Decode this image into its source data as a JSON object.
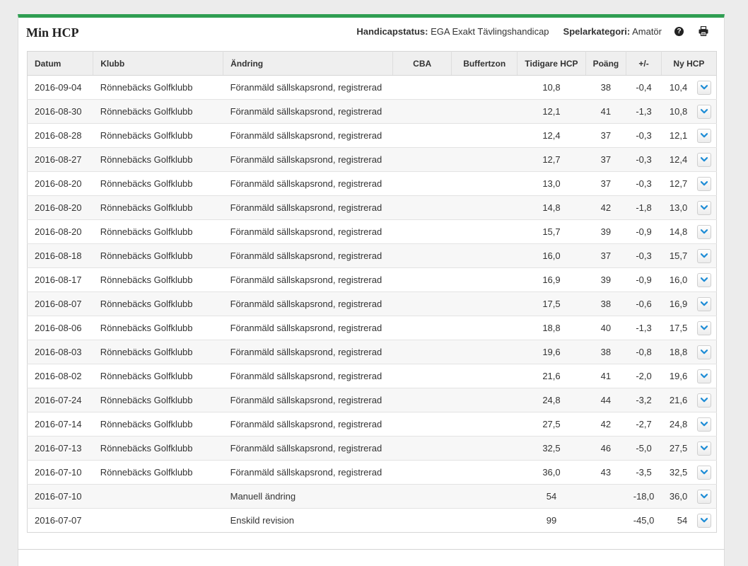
{
  "header": {
    "title": "Min HCP",
    "handicap_status_label": "Handicapstatus:",
    "handicap_status_value": "EGA Exakt Tävlingshandicap",
    "player_category_label": "Spelarkategori:",
    "player_category_value": "Amatör",
    "help_glyph": "?"
  },
  "colors": {
    "accent": "#2f9e52",
    "expand_chevron": "#1f8dd6"
  },
  "table": {
    "columns": [
      "Datum",
      "Klubb",
      "Ändring",
      "CBA",
      "Buffertzon",
      "Tidigare HCP",
      "Poäng",
      "+/-",
      "Ny HCP"
    ],
    "rows": [
      {
        "date": "2016-09-04",
        "club": "Rönnebäcks Golfklubb",
        "change": "Föranmäld sällskapsrond, registrerad",
        "cba": "",
        "buffer": "",
        "prev": "10,8",
        "points": "38",
        "diff": "-0,4",
        "new": "10,4"
      },
      {
        "date": "2016-08-30",
        "club": "Rönnebäcks Golfklubb",
        "change": "Föranmäld sällskapsrond, registrerad",
        "cba": "",
        "buffer": "",
        "prev": "12,1",
        "points": "41",
        "diff": "-1,3",
        "new": "10,8"
      },
      {
        "date": "2016-08-28",
        "club": "Rönnebäcks Golfklubb",
        "change": "Föranmäld sällskapsrond, registrerad",
        "cba": "",
        "buffer": "",
        "prev": "12,4",
        "points": "37",
        "diff": "-0,3",
        "new": "12,1"
      },
      {
        "date": "2016-08-27",
        "club": "Rönnebäcks Golfklubb",
        "change": "Föranmäld sällskapsrond, registrerad",
        "cba": "",
        "buffer": "",
        "prev": "12,7",
        "points": "37",
        "diff": "-0,3",
        "new": "12,4"
      },
      {
        "date": "2016-08-20",
        "club": "Rönnebäcks Golfklubb",
        "change": "Föranmäld sällskapsrond, registrerad",
        "cba": "",
        "buffer": "",
        "prev": "13,0",
        "points": "37",
        "diff": "-0,3",
        "new": "12,7"
      },
      {
        "date": "2016-08-20",
        "club": "Rönnebäcks Golfklubb",
        "change": "Föranmäld sällskapsrond, registrerad",
        "cba": "",
        "buffer": "",
        "prev": "14,8",
        "points": "42",
        "diff": "-1,8",
        "new": "13,0"
      },
      {
        "date": "2016-08-20",
        "club": "Rönnebäcks Golfklubb",
        "change": "Föranmäld sällskapsrond, registrerad",
        "cba": "",
        "buffer": "",
        "prev": "15,7",
        "points": "39",
        "diff": "-0,9",
        "new": "14,8"
      },
      {
        "date": "2016-08-18",
        "club": "Rönnebäcks Golfklubb",
        "change": "Föranmäld sällskapsrond, registrerad",
        "cba": "",
        "buffer": "",
        "prev": "16,0",
        "points": "37",
        "diff": "-0,3",
        "new": "15,7"
      },
      {
        "date": "2016-08-17",
        "club": "Rönnebäcks Golfklubb",
        "change": "Föranmäld sällskapsrond, registrerad",
        "cba": "",
        "buffer": "",
        "prev": "16,9",
        "points": "39",
        "diff": "-0,9",
        "new": "16,0"
      },
      {
        "date": "2016-08-07",
        "club": "Rönnebäcks Golfklubb",
        "change": "Föranmäld sällskapsrond, registrerad",
        "cba": "",
        "buffer": "",
        "prev": "17,5",
        "points": "38",
        "diff": "-0,6",
        "new": "16,9"
      },
      {
        "date": "2016-08-06",
        "club": "Rönnebäcks Golfklubb",
        "change": "Föranmäld sällskapsrond, registrerad",
        "cba": "",
        "buffer": "",
        "prev": "18,8",
        "points": "40",
        "diff": "-1,3",
        "new": "17,5"
      },
      {
        "date": "2016-08-03",
        "club": "Rönnebäcks Golfklubb",
        "change": "Föranmäld sällskapsrond, registrerad",
        "cba": "",
        "buffer": "",
        "prev": "19,6",
        "points": "38",
        "diff": "-0,8",
        "new": "18,8"
      },
      {
        "date": "2016-08-02",
        "club": "Rönnebäcks Golfklubb",
        "change": "Föranmäld sällskapsrond, registrerad",
        "cba": "",
        "buffer": "",
        "prev": "21,6",
        "points": "41",
        "diff": "-2,0",
        "new": "19,6"
      },
      {
        "date": "2016-07-24",
        "club": "Rönnebäcks Golfklubb",
        "change": "Föranmäld sällskapsrond, registrerad",
        "cba": "",
        "buffer": "",
        "prev": "24,8",
        "points": "44",
        "diff": "-3,2",
        "new": "21,6"
      },
      {
        "date": "2016-07-14",
        "club": "Rönnebäcks Golfklubb",
        "change": "Föranmäld sällskapsrond, registrerad",
        "cba": "",
        "buffer": "",
        "prev": "27,5",
        "points": "42",
        "diff": "-2,7",
        "new": "24,8"
      },
      {
        "date": "2016-07-13",
        "club": "Rönnebäcks Golfklubb",
        "change": "Föranmäld sällskapsrond, registrerad",
        "cba": "",
        "buffer": "",
        "prev": "32,5",
        "points": "46",
        "diff": "-5,0",
        "new": "27,5"
      },
      {
        "date": "2016-07-10",
        "club": "Rönnebäcks Golfklubb",
        "change": "Föranmäld sällskapsrond, registrerad",
        "cba": "",
        "buffer": "",
        "prev": "36,0",
        "points": "43",
        "diff": "-3,5",
        "new": "32,5"
      },
      {
        "date": "2016-07-10",
        "club": "",
        "change": "Manuell ändring",
        "cba": "",
        "buffer": "",
        "prev": "54",
        "points": "",
        "diff": "-18,0",
        "new": "36,0"
      },
      {
        "date": "2016-07-07",
        "club": "",
        "change": "Enskild revision",
        "cba": "",
        "buffer": "",
        "prev": "99",
        "points": "",
        "diff": "-45,0",
        "new": "54"
      }
    ]
  }
}
